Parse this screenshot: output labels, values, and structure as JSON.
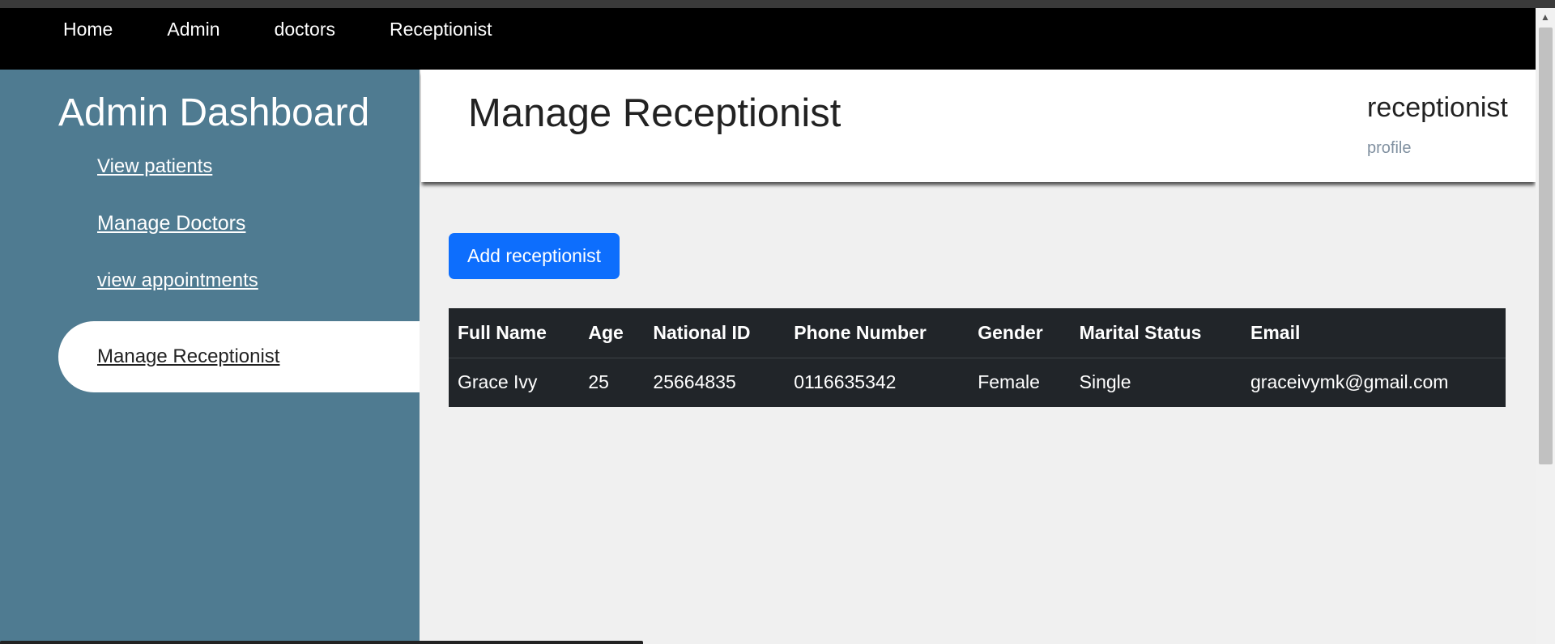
{
  "nav": {
    "items": [
      {
        "label": "Home"
      },
      {
        "label": "Admin"
      },
      {
        "label": "doctors"
      },
      {
        "label": "Receptionist"
      }
    ]
  },
  "sidebar": {
    "title": "Admin Dashboard",
    "links": [
      {
        "label": "View patients"
      },
      {
        "label": "Manage Doctors"
      },
      {
        "label": "view appointments"
      },
      {
        "label": "Manage Receptionist"
      }
    ]
  },
  "header": {
    "title": "Manage Receptionist",
    "user": "receptionist",
    "profile": "profile"
  },
  "actions": {
    "add_label": "Add receptionist"
  },
  "table": {
    "columns": [
      "Full Name",
      "Age",
      "National ID",
      "Phone Number",
      "Gender",
      "Marital Status",
      "Email"
    ],
    "rows": [
      [
        "Grace Ivy",
        "25",
        "25664835",
        "0116635342",
        "Female",
        "Single",
        "graceivymk@gmail.com"
      ]
    ]
  },
  "colors": {
    "sidebar": "#4f7b91",
    "nav": "#000000",
    "accent": "#0d6efd",
    "table": "#212529"
  }
}
